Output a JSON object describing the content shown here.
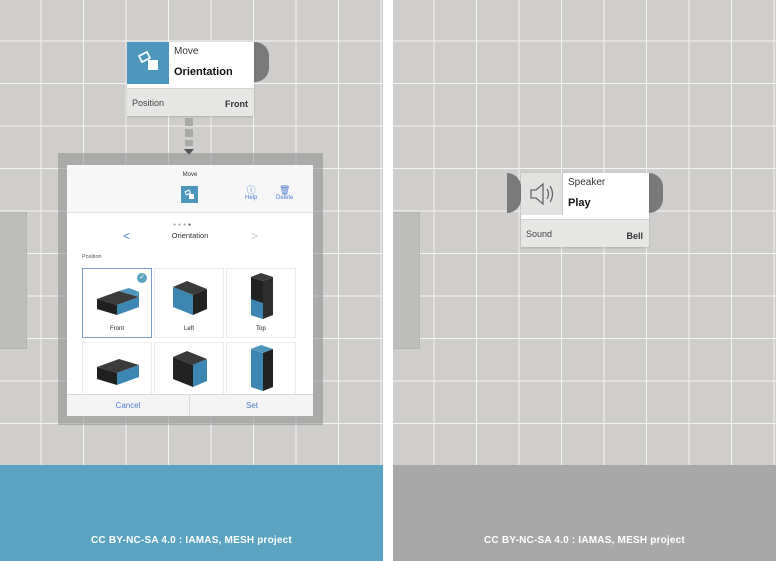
{
  "left_panel": {
    "block": {
      "category": "Move",
      "name": "Orientation",
      "prop_label": "Position",
      "prop_value": "Front",
      "icon": "rotate-tag-icon"
    },
    "modal": {
      "title": "Move",
      "help_label": "Help",
      "delete_label": "Delete",
      "subtitle": "Orientation",
      "section": "Position",
      "tiles": [
        {
          "label": "Front",
          "selected": true
        },
        {
          "label": "Left",
          "selected": false
        },
        {
          "label": "Top",
          "selected": false
        },
        {
          "label": "",
          "selected": false
        },
        {
          "label": "",
          "selected": false
        },
        {
          "label": "",
          "selected": false
        }
      ],
      "cancel_label": "Cancel",
      "set_label": "Set"
    },
    "footer": {
      "credit": "CC BY-NC-SA 4.0 : IAMAS, MESH project",
      "color": "#5aa3c1"
    }
  },
  "right_panel": {
    "block": {
      "category": "Speaker",
      "name": "Play",
      "prop_label": "Sound",
      "prop_value": "Bell",
      "icon": "speaker-icon"
    },
    "footer": {
      "credit": "CC BY-NC-SA 4.0 : IAMAS, MESH project",
      "color": "#a8a8a8"
    }
  },
  "colors": {
    "accent": "#4d97bd",
    "link": "#4d7fd0",
    "grid": "#cfcecc"
  }
}
